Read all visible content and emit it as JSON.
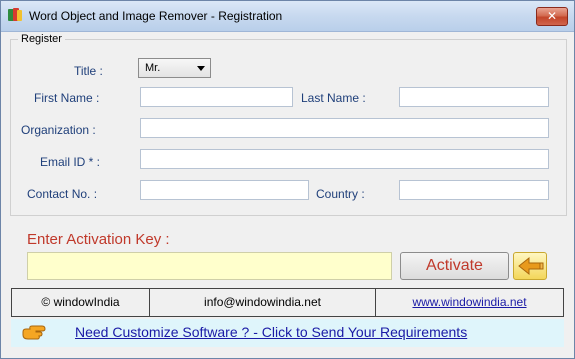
{
  "window": {
    "title": "Word Object and Image Remover - Registration",
    "close_glyph": "✕"
  },
  "register": {
    "legend": "Register",
    "title_label": "Title :",
    "title_value": "Mr.",
    "first_name_label": "First Name :",
    "first_name_value": "",
    "last_name_label": "Last Name :",
    "last_name_value": "",
    "organization_label": "Organization :",
    "organization_value": "",
    "email_label": "Email ID * :",
    "email_value": "",
    "contact_label": "Contact No. :",
    "contact_value": "",
    "country_label": "Country :",
    "country_value": ""
  },
  "activation": {
    "label": "Enter Activation Key  :",
    "key_value": "",
    "activate_button": "Activate",
    "back_icon": "back-arrow-icon"
  },
  "footer": {
    "copyright": "© windowIndia",
    "email": "info@windowindia.net",
    "website": "www.windowindia.net"
  },
  "banner": {
    "icon": "pointing-hand-icon",
    "link_text": "Need Customize Software ? - Click to Send Your Requirements"
  },
  "colors": {
    "label_blue": "#1f3f7a",
    "activation_red": "#c0392b",
    "activation_field_bg": "#ffffcc",
    "banner_bg": "#dff5fb",
    "link_blue": "#1a1aa6"
  }
}
